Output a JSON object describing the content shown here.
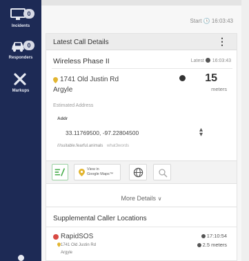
{
  "nav": {
    "items": [
      {
        "label": "Incidents",
        "badge": "0",
        "icon": "monitor-icon"
      },
      {
        "label": "Responders",
        "badge": "0",
        "icon": "car-icon"
      },
      {
        "label": "Markups",
        "icon": "tools-icon"
      }
    ]
  },
  "header": {
    "start_label": "Start",
    "start_time": "16:03:43"
  },
  "call": {
    "panel_title": "Latest Call Details",
    "call_type": "Wireless Phase II",
    "latest_label": "Latest",
    "latest_time": "16:03:43",
    "address": "1741 Old Justin Rd",
    "city": "Argyle",
    "estimated_label": "Estimated Address",
    "uncertainty_value": "15",
    "uncertainty_unit": "meters",
    "coordinate_label": "Addr",
    "coordinates": "33.11769500, -97.22804500",
    "what3words": "///suitable.fearful.animals",
    "what3words_lang": "what3words"
  },
  "toolbar": {
    "maps_line1": "View in",
    "maps_line2": "Google Maps™"
  },
  "more_details": "More Details",
  "supplemental": {
    "title": "Supplemental Caller Locations",
    "items": [
      {
        "source": "RapidSOS",
        "address": "1741 Old Justin Rd",
        "city": "Argyle",
        "time": "17:10:54",
        "uncertainty": "2.5 meters"
      }
    ]
  },
  "colors": {
    "nav_bg": "#1d2a55",
    "rapidsos_dot": "#d84a43"
  }
}
